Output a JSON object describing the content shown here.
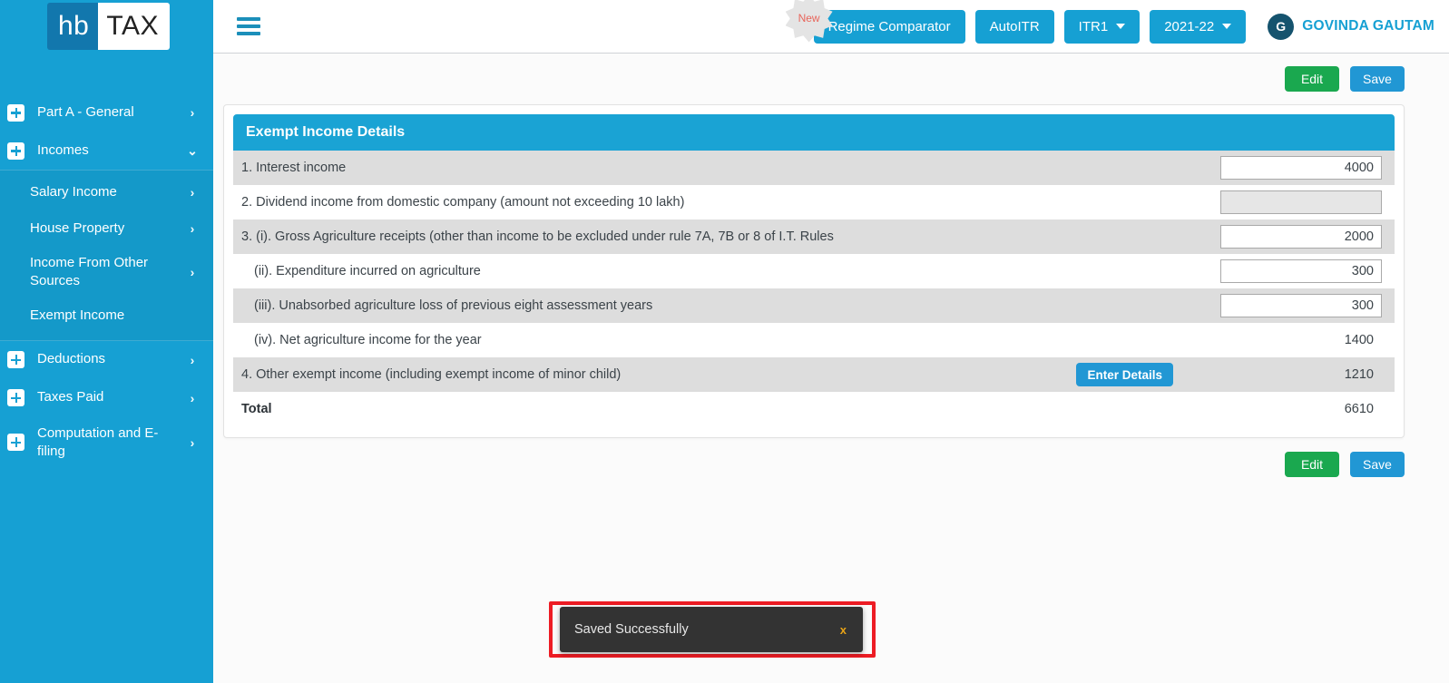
{
  "brand": {
    "logo_left": "hb",
    "logo_right": "TAX",
    "accent": "#16a0d3"
  },
  "sidebar": {
    "items": [
      {
        "label": "Part A - General",
        "icon": "plus-box-icon",
        "chevron": "›",
        "has_icon": true
      },
      {
        "label": "Incomes",
        "icon": "plus-box-icon",
        "chevron": "⌄",
        "has_icon": true
      }
    ],
    "submenu": [
      {
        "label": "Salary Income",
        "chevron": "›"
      },
      {
        "label": "House Property",
        "chevron": "›"
      },
      {
        "label": "Income From Other Sources",
        "chevron": "›"
      },
      {
        "label": "Exempt Income",
        "chevron": ""
      }
    ],
    "items_after": [
      {
        "label": "Deductions",
        "icon": "plus-box-icon",
        "chevron": "›",
        "has_icon": true
      },
      {
        "label": "Taxes Paid",
        "icon": "plus-box-icon",
        "chevron": "›",
        "has_icon": true
      },
      {
        "label": "Computation and E-filing",
        "icon": "plus-box-icon",
        "chevron": "›",
        "has_icon": true
      }
    ]
  },
  "topbar": {
    "menu_icon": "hamburger-icon",
    "new_badge": "New",
    "regime_comparator": "Regime Comparator",
    "auto_itr": "AutoITR",
    "itr_select": "ITR1",
    "year_select": "2021-22",
    "avatar_initial": "G",
    "user_name": "GOVINDA GAUTAM"
  },
  "actions": {
    "edit": "Edit",
    "save": "Save"
  },
  "card": {
    "title": "Exempt Income Details",
    "rows": [
      {
        "label": "1. Interest income",
        "indent": false,
        "type": "input",
        "value": "4000",
        "disabled": false,
        "shaded": true
      },
      {
        "label": "2. Dividend income from domestic company (amount not exceeding 10 lakh)",
        "indent": false,
        "type": "input",
        "value": "",
        "disabled": true,
        "shaded": false
      },
      {
        "label": "3. (i). Gross Agriculture receipts (other than income to be excluded under rule 7A, 7B or 8 of I.T. Rules",
        "indent": false,
        "type": "input",
        "value": "2000",
        "disabled": false,
        "shaded": true
      },
      {
        "label": "(ii). Expenditure incurred on agriculture",
        "indent": true,
        "type": "input",
        "value": "300",
        "disabled": false,
        "shaded": false
      },
      {
        "label": "(iii). Unabsorbed agriculture loss of previous eight assessment years",
        "indent": true,
        "type": "input",
        "value": "300",
        "disabled": false,
        "shaded": true
      },
      {
        "label": "(iv). Net agriculture income for the year",
        "indent": true,
        "type": "readonly",
        "value": "1400",
        "shaded": false
      },
      {
        "label": "4. Other exempt income (including exempt income of minor child)",
        "indent": false,
        "type": "readonly",
        "value": "1210",
        "shaded": true,
        "button": "Enter Details"
      },
      {
        "label": "Total",
        "indent": false,
        "type": "readonly",
        "value": "6610",
        "shaded": false,
        "bold": true
      }
    ]
  },
  "toast": {
    "message": "Saved Successfully",
    "close_label": "x",
    "highlight_color": "#ed1c24"
  }
}
